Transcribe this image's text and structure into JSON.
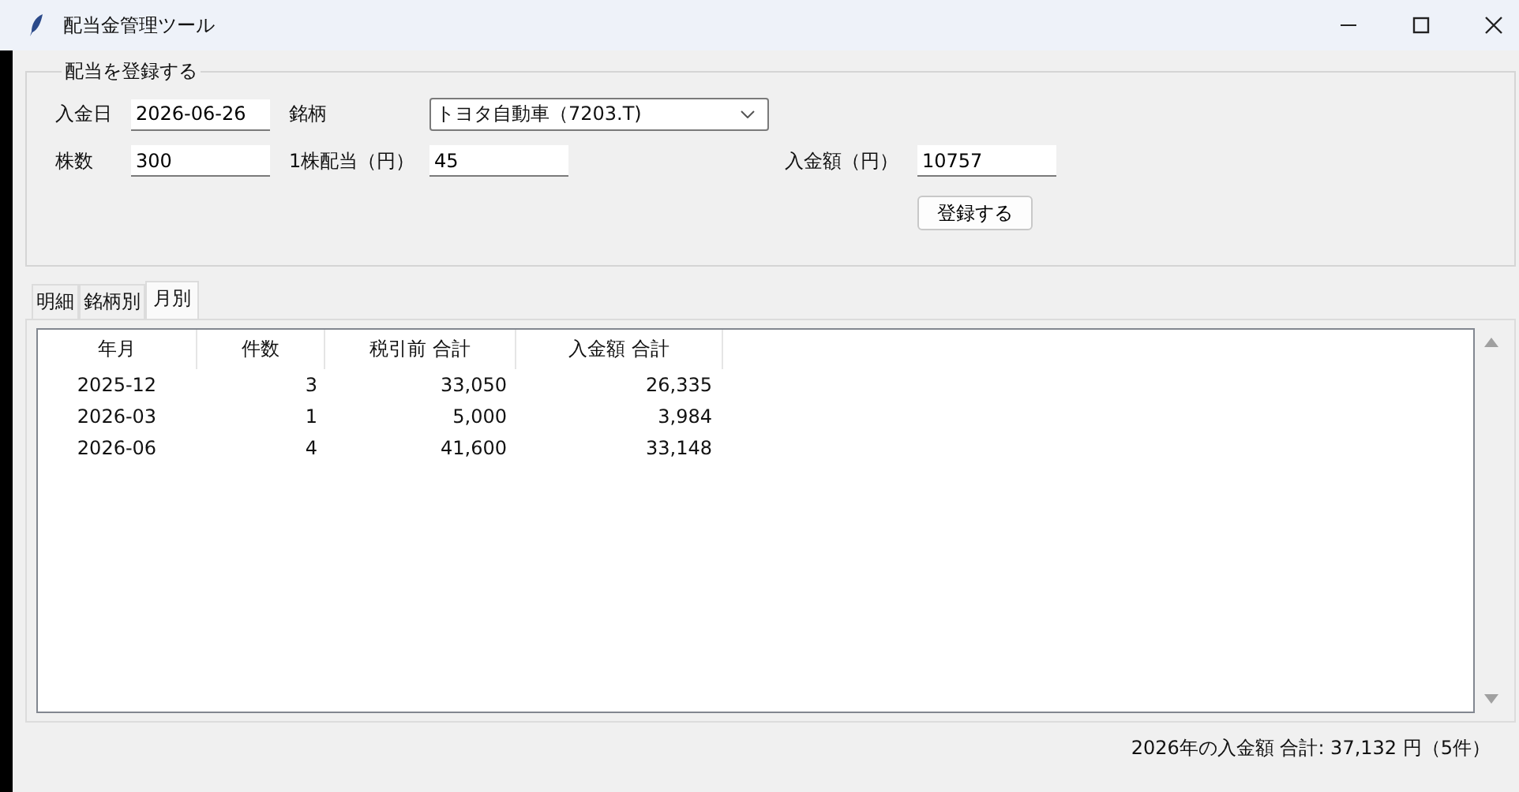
{
  "window": {
    "title": "配当金管理ツール"
  },
  "form": {
    "title": "配当を登録する",
    "rows": [
      [
        {
          "kind": "label",
          "text": "入金日"
        },
        {
          "kind": "text",
          "value": "2026-06-26"
        },
        {
          "kind": "label",
          "text": "銘柄"
        },
        {
          "kind": "combo",
          "value": "トヨタ自動車（7203.T)"
        }
      ],
      [
        {
          "kind": "label",
          "text": "株数"
        },
        {
          "kind": "text",
          "value": "300"
        },
        {
          "kind": "label",
          "text": "1株配当（円）"
        },
        {
          "kind": "text",
          "value": "45"
        },
        {
          "kind": "label",
          "text": "入金額（円）"
        },
        {
          "kind": "text",
          "value": "10757"
        }
      ]
    ],
    "button": "登録する"
  },
  "tabs": [
    {
      "label": "明細",
      "selected": false
    },
    {
      "label": "銘柄別",
      "selected": false
    },
    {
      "label": "月別",
      "selected": true
    }
  ],
  "table": {
    "columns": [
      "年月",
      "件数",
      "税引前 合計",
      "入金額 合計"
    ],
    "rows": [
      [
        "2025-12",
        "3",
        "33,050",
        "26,335"
      ],
      [
        "2026-03",
        "1",
        "5,000",
        "3,984"
      ],
      [
        "2026-06",
        "4",
        "41,600",
        "33,148"
      ]
    ]
  },
  "status_bar": "2026年の入金額 合計: 37,132 円（5件）"
}
